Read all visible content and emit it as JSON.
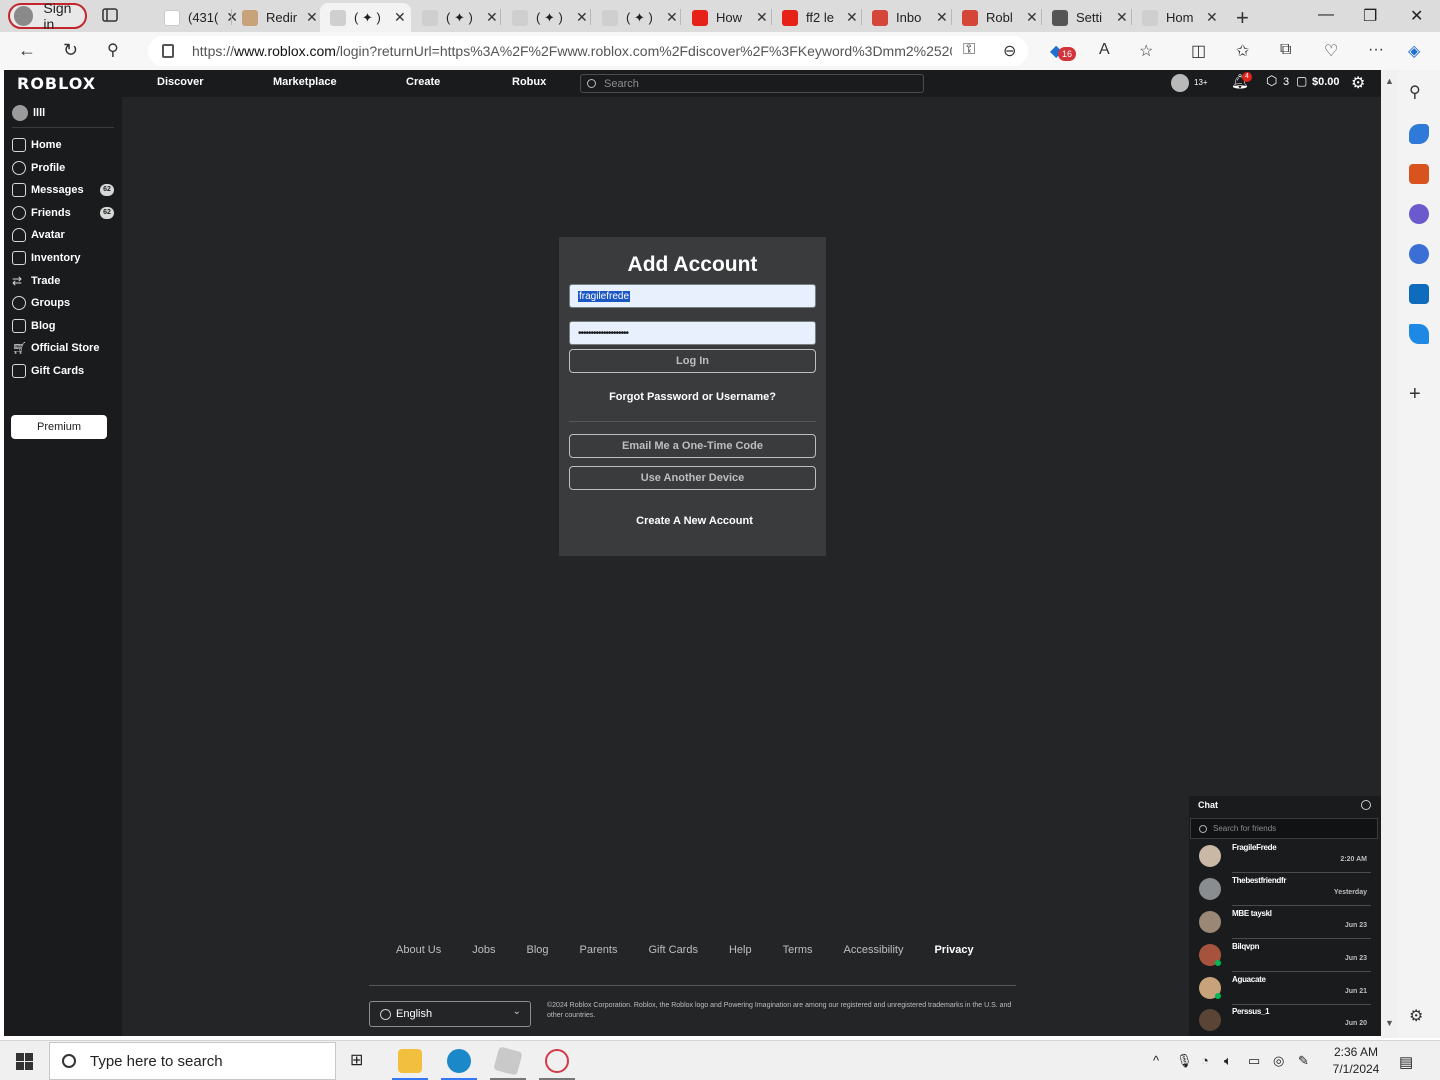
{
  "browser": {
    "profile_label": "Sign in",
    "tabs": [
      {
        "label": "(431(",
        "color": "#ffffff"
      },
      {
        "label": "Redir",
        "color": "#c7a27a"
      },
      {
        "label": "( ✦ )",
        "color": "#cfcfcf",
        "active": true
      },
      {
        "label": "( ✦ )",
        "color": "#cfcfcf"
      },
      {
        "label": "( ✦ )",
        "color": "#cfcfcf"
      },
      {
        "label": "( ✦ )",
        "color": "#cfcfcf"
      },
      {
        "label": "How",
        "color": "#e62117"
      },
      {
        "label": "ff2 le",
        "color": "#e62117"
      },
      {
        "label": "Inbo",
        "color": "#d44638"
      },
      {
        "label": "Robl",
        "color": "#d44638"
      },
      {
        "label": "Setti",
        "color": "#555555"
      },
      {
        "label": "Hom",
        "color": "#cfcfcf"
      }
    ],
    "url_prefix": "https://",
    "url_domain": "www.roblox.com",
    "url_rest": "/login?returnUrl=https%3A%2F%2Fwww.roblox.com%2Fdiscover%2F%3FKeyword%3Dmm2%2520",
    "extension_badge": "16"
  },
  "roblox": {
    "logo": "ROBLOX",
    "nav": {
      "discover": "Discover",
      "marketplace": "Marketplace",
      "create": "Create",
      "robux": "Robux",
      "search_placeholder": "Search",
      "age_label": "13+",
      "notifications_count": "4",
      "robux_count": "3",
      "balance": "$0.00"
    },
    "sidebar": {
      "username": "llll",
      "items": [
        {
          "label": "Home"
        },
        {
          "label": "Profile"
        },
        {
          "label": "Messages",
          "count": "62"
        },
        {
          "label": "Friends",
          "count": "62"
        },
        {
          "label": "Avatar"
        },
        {
          "label": "Inventory"
        },
        {
          "label": "Trade"
        },
        {
          "label": "Groups"
        },
        {
          "label": "Blog"
        },
        {
          "label": "Official Store"
        },
        {
          "label": "Gift Cards"
        }
      ],
      "premium": "Premium"
    },
    "login": {
      "title": "Add Account",
      "username_value": "fragilefrede",
      "password_mask": "••••••••••••••••••••",
      "login_button": "Log In",
      "forgot": "Forgot Password or Username?",
      "email_code": "Email Me a One-Time Code",
      "another_device": "Use Another Device",
      "create_account": "Create A New Account"
    },
    "footer": {
      "links": [
        "About Us",
        "Jobs",
        "Blog",
        "Parents",
        "Gift Cards",
        "Help",
        "Terms",
        "Accessibility",
        "Privacy"
      ],
      "language": "English",
      "copyright": "©2024 Roblox Corporation. Roblox, the Roblox logo and Powering Imagination are among our registered and unregistered trademarks in the U.S. and other countries."
    },
    "chat": {
      "title": "Chat",
      "search_placeholder": "Search for friends",
      "conversations": [
        {
          "name": "FragileFrede",
          "time": "2:20 AM"
        },
        {
          "name": "Thebestfriendfr",
          "time": "Yesterday"
        },
        {
          "name": "MBE tayskl",
          "time": "Jun 23"
        },
        {
          "name": "Bilqvpn",
          "time": "Jun 23"
        },
        {
          "name": "Aguacate",
          "time": "Jun 21"
        },
        {
          "name": "Perssus_1",
          "time": "Jun 20"
        }
      ]
    }
  },
  "taskbar": {
    "search_placeholder": "Type here to search",
    "time": "2:36 AM",
    "date": "7/1/2024"
  }
}
